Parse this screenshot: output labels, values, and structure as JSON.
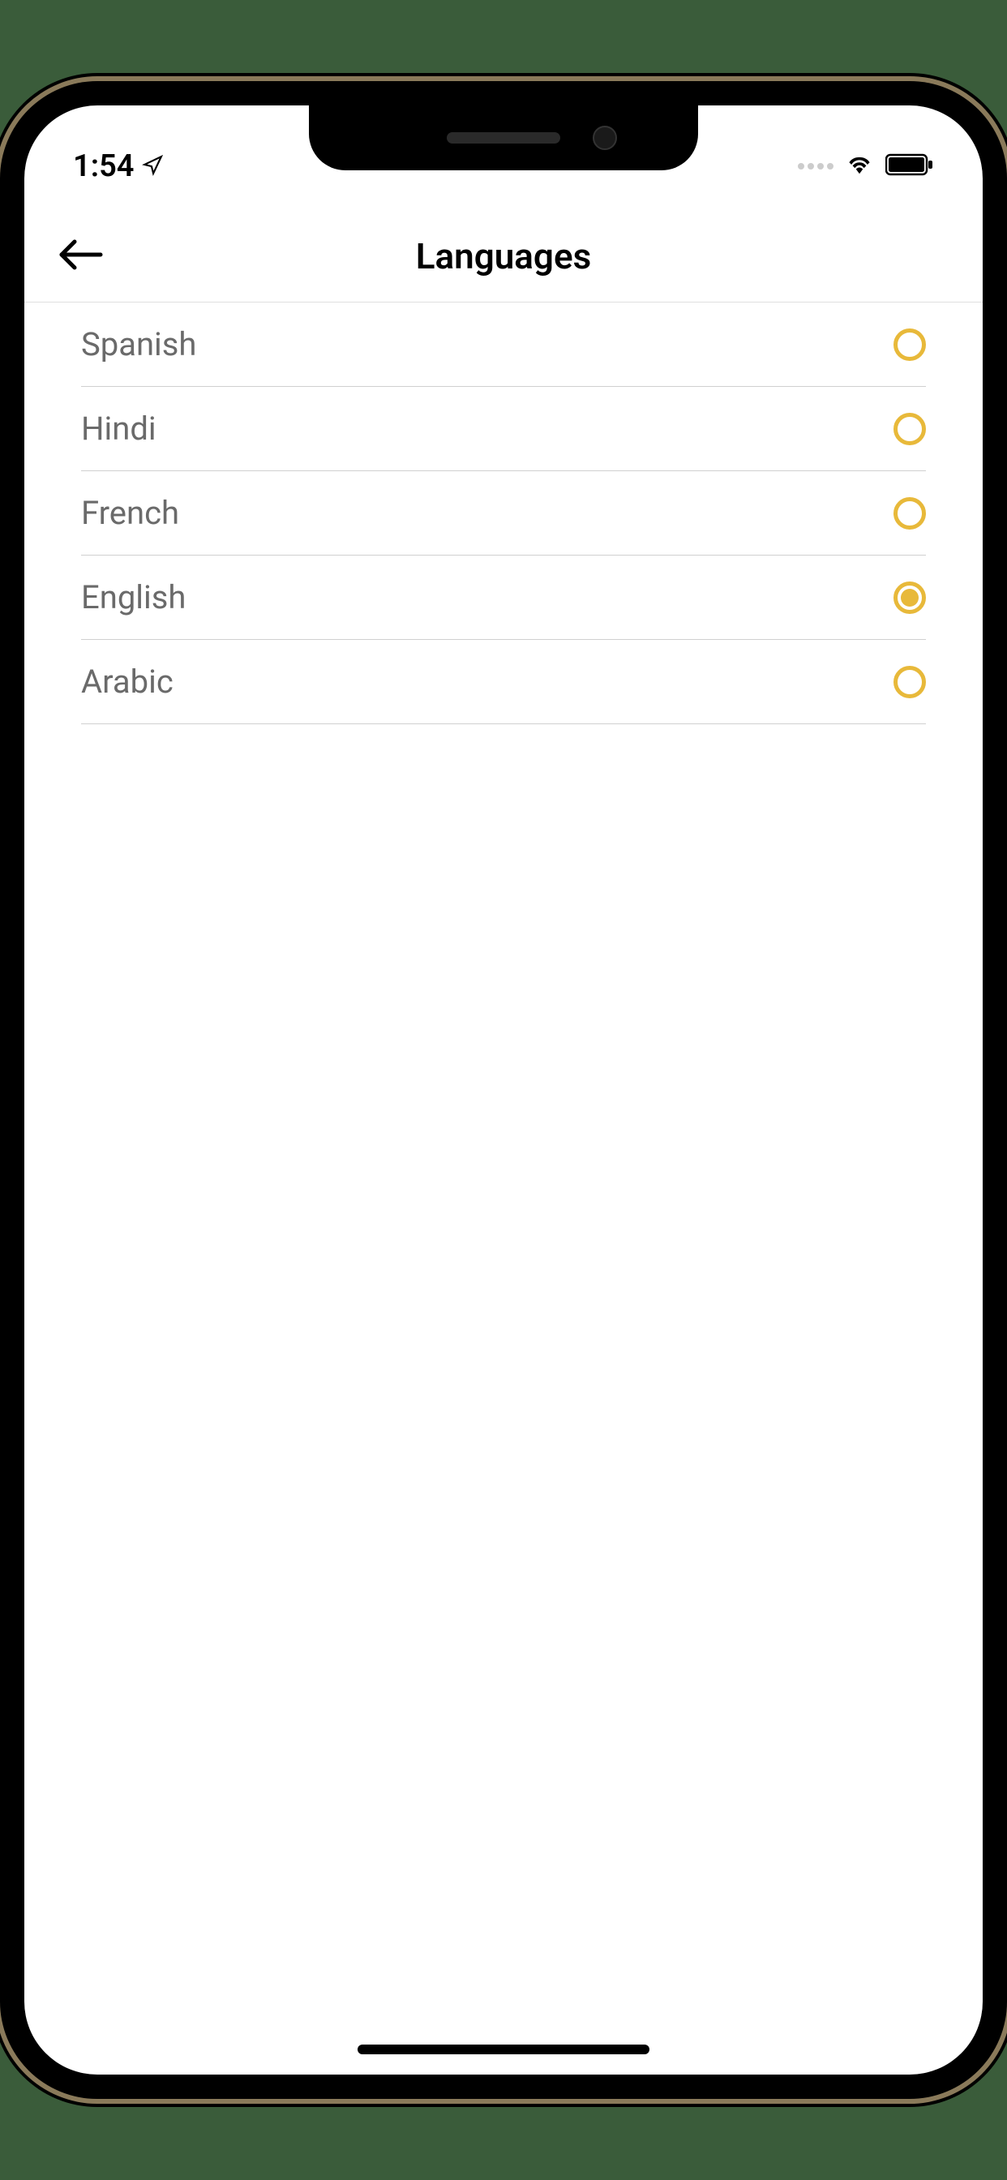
{
  "status_bar": {
    "time": "1:54"
  },
  "header": {
    "title": "Languages"
  },
  "languages": [
    {
      "label": "Spanish",
      "selected": false
    },
    {
      "label": "Hindi",
      "selected": false
    },
    {
      "label": "French",
      "selected": false
    },
    {
      "label": "English",
      "selected": true
    },
    {
      "label": "Arabic",
      "selected": false
    }
  ],
  "colors": {
    "accent": "#e8b93a",
    "text_muted": "#6a6a6a",
    "divider": "#d0d0d0"
  }
}
